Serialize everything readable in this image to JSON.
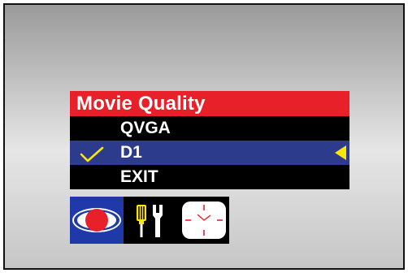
{
  "menu": {
    "title": "Movie Quality",
    "items": [
      {
        "label": "QVGA",
        "selected": false
      },
      {
        "label": "D1",
        "selected": true
      },
      {
        "label": "EXIT",
        "selected": false
      }
    ]
  },
  "icon_tabs": [
    {
      "icon": "record-mode-icon",
      "active": true
    },
    {
      "icon": "setup-tools-icon",
      "active": false
    },
    {
      "icon": "clock-icon",
      "active": false
    }
  ],
  "colors": {
    "title_bar": "#e8202a",
    "selected_row": "#2d3b8c",
    "highlight": "#ffe600",
    "mode_tab": "#1f39a8"
  }
}
